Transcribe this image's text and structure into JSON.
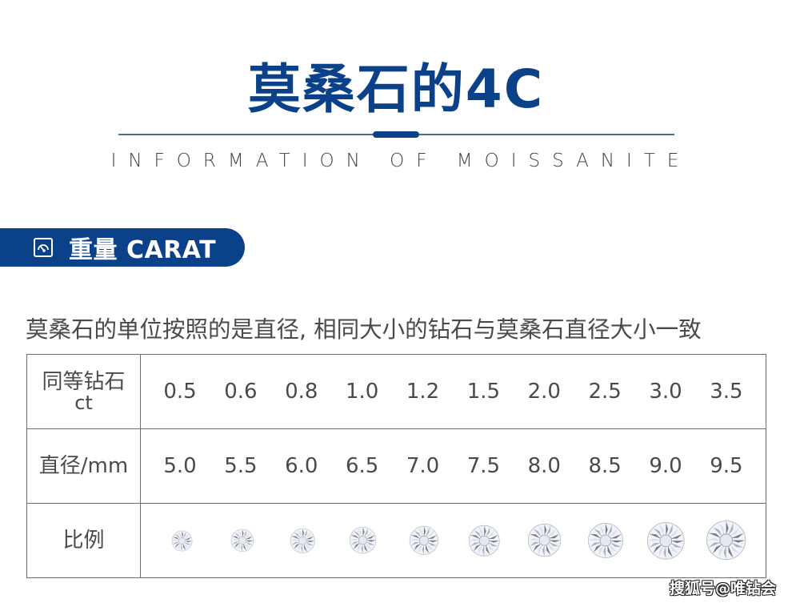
{
  "header": {
    "title": "莫桑石的4C",
    "subtitle": "INFORMATION OF MOISSANITE",
    "accent_color": "#0b4189"
  },
  "section": {
    "icon": "gauge-icon",
    "label": "重量 CARAT"
  },
  "description": "莫桑石的单位按照的是直径, 相同大小的钻石与莫桑石直径大小一致",
  "table": {
    "rows": [
      {
        "label": "同等钻石",
        "sublabel": "ct",
        "values": [
          "0.5",
          "0.6",
          "0.8",
          "1.0",
          "1.2",
          "1.5",
          "2.0",
          "2.5",
          "3.0",
          "3.5"
        ]
      },
      {
        "label": "直径/mm",
        "values": [
          "5.0",
          "5.5",
          "6.0",
          "6.5",
          "7.0",
          "7.5",
          "8.0",
          "8.5",
          "9.0",
          "9.5"
        ]
      },
      {
        "label": "比例",
        "icon": "diamond-icon",
        "diameters_mm": [
          5.0,
          5.5,
          6.0,
          6.5,
          7.0,
          7.5,
          8.0,
          8.5,
          9.0,
          9.5
        ]
      }
    ]
  },
  "watermark": "搜狐号@唯钻会"
}
